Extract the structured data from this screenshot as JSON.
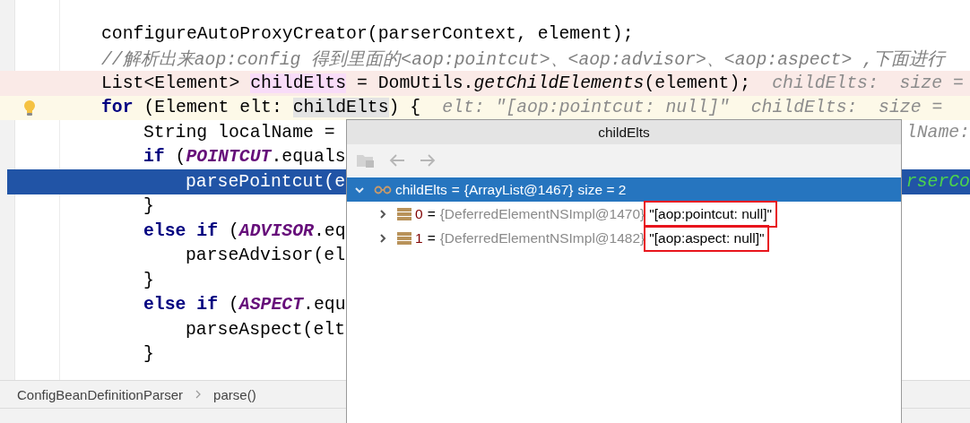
{
  "code_lines": [
    {
      "kind": "plain",
      "bulb": false,
      "code": [
        {
          "text": "configureAutoProxyCreator(parserContext, element);",
          "kind": "plain"
        }
      ]
    },
    {
      "kind": "plain",
      "bulb": false,
      "code": [
        {
          "text": "//解析出来aop:config 得到里面的<aop:pointcut>、<aop:advisor>、<aop:aspect> ,下面进行",
          "kind": "comment"
        }
      ]
    },
    {
      "kind": "breakpoint",
      "bulb": false,
      "code": [
        {
          "text": "List<Element> ",
          "kind": "plain"
        },
        {
          "text": "childElts",
          "kind": "write_ref"
        },
        {
          "text": " = DomUtils.",
          "kind": "plain"
        },
        {
          "text": "getChildElements",
          "kind": "method"
        },
        {
          "text": "(element);",
          "kind": "plain"
        }
      ],
      "hints": [
        "childElts:  size ="
      ]
    },
    {
      "kind": "caret",
      "bulb": true,
      "code": [
        {
          "text": "for",
          "kind": "keyword"
        },
        {
          "text": " (Element elt: ",
          "kind": "plain"
        },
        {
          "text": "childElts",
          "kind": "read_ref"
        },
        {
          "text": ") {",
          "kind": "plain"
        }
      ],
      "hints": [
        "elt: \"[aop:pointcut: null]\"",
        "childElts:  size ="
      ],
      "children": [
        {
          "kind": "plain",
          "bulb": false,
          "code": [
            {
              "text": "String localName =",
              "kind": "plain"
            }
          ],
          "tail": "lName:"
        },
        {
          "kind": "plain",
          "bulb": false,
          "code": [
            {
              "text": "if",
              "kind": "keyword"
            },
            {
              "text": " (",
              "kind": "plain"
            },
            {
              "text": "POINTCUT",
              "kind": "constant"
            },
            {
              "text": ".equals",
              "kind": "plain"
            }
          ],
          "children": [
            {
              "kind": "execution",
              "bulb": false,
              "code": [
                {
                  "text": "parsePointcut(e",
                  "kind": "plain"
                }
              ],
              "tail": "rserCo"
            }
          ]
        },
        {
          "kind": "plain",
          "bulb": false,
          "code": [
            {
              "text": "}",
              "kind": "plain"
            }
          ]
        },
        {
          "kind": "plain",
          "bulb": false,
          "code": [
            {
              "text": "else if",
              "kind": "keyword"
            },
            {
              "text": " (",
              "kind": "plain"
            },
            {
              "text": "ADVISOR",
              "kind": "constant"
            },
            {
              "text": ".eq",
              "kind": "plain"
            }
          ],
          "children": [
            {
              "kind": "plain",
              "bulb": false,
              "code": [
                {
                  "text": "parseAdvisor(el",
                  "kind": "plain"
                }
              ]
            }
          ]
        },
        {
          "kind": "plain",
          "bulb": false,
          "code": [
            {
              "text": "}",
              "kind": "plain"
            }
          ]
        },
        {
          "kind": "plain",
          "bulb": false,
          "code": [
            {
              "text": "else if",
              "kind": "keyword"
            },
            {
              "text": " (",
              "kind": "plain"
            },
            {
              "text": "ASPECT",
              "kind": "constant"
            },
            {
              "text": ".equ",
              "kind": "plain"
            }
          ],
          "children": [
            {
              "kind": "plain",
              "bulb": false,
              "code": [
                {
                  "text": "parseAspect(elt",
                  "kind": "plain"
                }
              ]
            }
          ]
        },
        {
          "kind": "plain",
          "bulb": false,
          "code": [
            {
              "text": "}",
              "kind": "plain"
            }
          ]
        }
      ]
    }
  ],
  "breadcrumb": [
    "ConfigBeanDefinitionParser",
    "parse()"
  ],
  "popup": {
    "title": "childElts",
    "toolbar": [
      {
        "kind": "folder",
        "disabled": true
      },
      {
        "kind": "back",
        "disabled": true
      },
      {
        "kind": "forward",
        "disabled": true
      }
    ],
    "tree": [
      {
        "kind": "list",
        "name": "childElts",
        "equals": "=",
        "type": "{ArrayList@1467}",
        "value": "size = 2",
        "expanded": true,
        "selected": true,
        "boxed": false,
        "children": [
          {
            "kind": "element",
            "name": "0",
            "equals": "=",
            "type": "{DeferredElementNSImpl@1470}",
            "value": "\"[aop:pointcut: null]\"",
            "expanded": false,
            "selected": false,
            "boxed": true
          },
          {
            "kind": "element",
            "name": "1",
            "equals": "=",
            "type": "{DeferredElementNSImpl@1482}",
            "value": "\"[aop:aspect: null]\"",
            "expanded": false,
            "selected": false,
            "boxed": true
          }
        ]
      }
    ]
  }
}
